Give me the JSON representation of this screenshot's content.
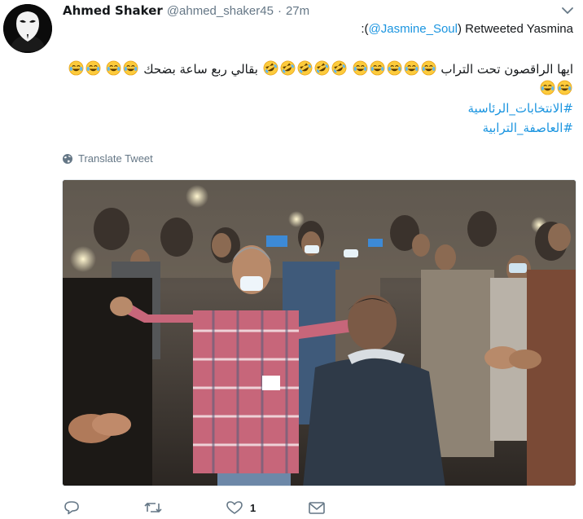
{
  "tweet": {
    "author_name": "Ahmed Shaker",
    "handle": "@ahmed_shaker45",
    "separator": "·",
    "timestamp": "27m",
    "retweet_prefix": ":(",
    "retweet_mention": "@Jasmine_Soul",
    "retweet_suffix": ") Retweeted Yasmina",
    "text_part1": "ايها الراقصون تحت التراب",
    "text_part2": "بقالي ربع ساعة بضحك",
    "hashtags": [
      "#الانتخابات_الرئاسية",
      "#العاصفة_الترابية"
    ],
    "translate_label": "Translate Tweet"
  },
  "actions": {
    "reply_count": "",
    "retweet_count": "",
    "like_count": "1",
    "dm_count": ""
  },
  "icons": {
    "avatar": "anonymous-mask-avatar",
    "caret": "chevron-down-icon",
    "globe": "globe-icon",
    "reply": "reply-icon",
    "retweet": "retweet-icon",
    "like": "heart-icon",
    "dm": "envelope-icon",
    "emoji_tears": "face-with-tears-of-joy-emoji",
    "emoji_rofl": "rolling-on-the-floor-laughing-emoji"
  },
  "colors": {
    "link": "#1b95e0",
    "secondary": "#657786",
    "text": "#14171a"
  }
}
